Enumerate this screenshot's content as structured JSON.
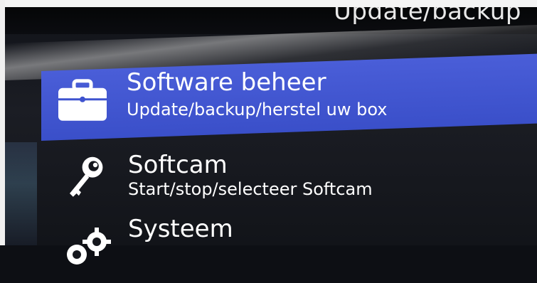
{
  "header": {
    "title": "Update/backup"
  },
  "menu": {
    "items": [
      {
        "label": "Software beheer",
        "sublabel": "Update/backup/herstel uw box",
        "icon": "briefcase-icon",
        "selected": true
      },
      {
        "label": "Softcam",
        "sublabel": "Start/stop/selecteer Softcam",
        "icon": "key-icon",
        "selected": false
      },
      {
        "label": "Systeem",
        "sublabel": "",
        "icon": "gears-icon",
        "selected": false
      }
    ]
  },
  "colors": {
    "highlight": "#3e53cf",
    "background": "#15171d",
    "text": "#ffffff"
  }
}
